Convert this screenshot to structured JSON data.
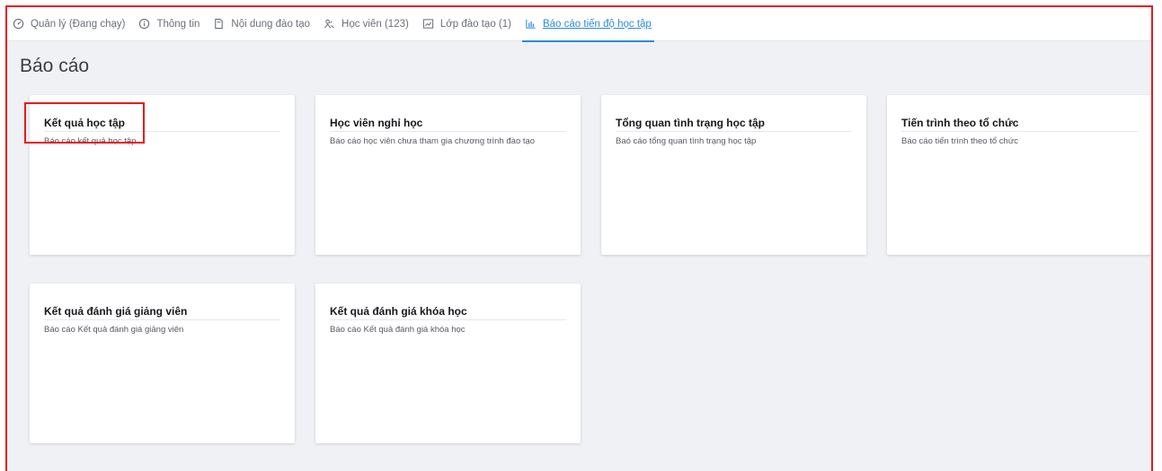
{
  "tabs": [
    {
      "label": "Quản lý (Đang chạy)",
      "icon": "dashboard-icon"
    },
    {
      "label": "Thông tin",
      "icon": "info-icon"
    },
    {
      "label": "Nội dung đào tạo",
      "icon": "document-icon"
    },
    {
      "label": "Học viên (123)",
      "icon": "users-icon"
    },
    {
      "label": "Lớp đào tạo (1)",
      "icon": "chart-line-icon"
    },
    {
      "label": "Báo cáo tiến độ học tập",
      "icon": "bar-chart-icon",
      "active": true
    }
  ],
  "page_title": "Báo cáo",
  "reports": [
    {
      "title": "Kết quả học tập",
      "description": "Báo cáo kết quả học tập"
    },
    {
      "title": "Học viên nghỉ học",
      "description": "Báo cáo học viên chưa tham gia chương trình đào tạo"
    },
    {
      "title": "Tổng quan tình trạng học tập",
      "description": "Baó cáo tổng quan tình trạng học tập"
    },
    {
      "title": "Tiến trình theo tổ chức",
      "description": "Báo cáo tiến trình theo tổ chức"
    },
    {
      "title": "Kết quả đánh giá giảng viên",
      "description": "Báo cáo Kết quả đánh giá giảng viên"
    },
    {
      "title": "Kết quả đánh giá khóa học",
      "description": "Báo cáo Kết quả đánh giá khóa học"
    }
  ],
  "colors": {
    "accent": "#2d8ad8",
    "highlight": "#e8191c",
    "background": "#f0f1f4"
  }
}
